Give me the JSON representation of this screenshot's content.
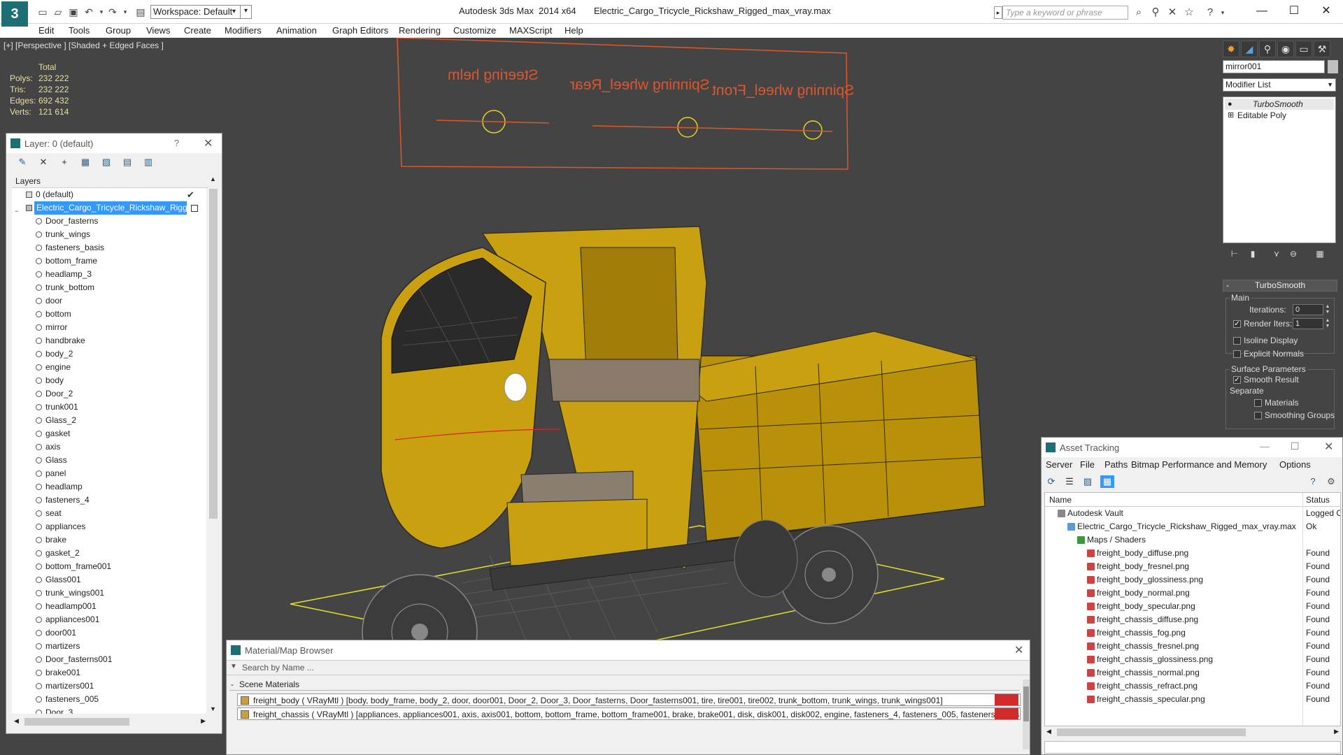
{
  "titlebar": {
    "app_logo": "3",
    "workspace": "Workspace: Default",
    "title": "Autodesk 3ds Max  2014 x64       Electric_Cargo_Tricycle_Rickshaw_Rigged_max_vray.max",
    "search_placeholder": "Type a keyword or phrase",
    "icons": [
      "binoculars-icon",
      "search-icon",
      "exchange-icon",
      "star-icon",
      "help-icon"
    ]
  },
  "menu": [
    "Edit",
    "Tools",
    "Group",
    "Views",
    "Create",
    "Modifiers",
    "Animation",
    "Graph Editors",
    "Rendering",
    "Customize",
    "MAXScript",
    "Help"
  ],
  "viewport": {
    "label": "[+] [Perspective ] [Shaded + Edged Faces ]",
    "stats": {
      "header": "Total",
      "rows": [
        {
          "label": "Polys:",
          "value": "232 222"
        },
        {
          "label": "Tris:",
          "value": "232 222"
        },
        {
          "label": "Edges:",
          "value": "692 432"
        },
        {
          "label": "Verts:",
          "value": "121 614"
        }
      ]
    },
    "rig_labels": [
      "Steering helm",
      "Spinning wheel_Rear",
      "Spinning wheel_Front"
    ],
    "colors": {
      "rig": "#e0552a",
      "vehicle": "#c8a010",
      "selection": "#e8e020"
    }
  },
  "layer_explorer": {
    "title": "Layer: 0 (default)",
    "help": "?",
    "header": "Layers",
    "default_layer": "0 (default)",
    "selected_layer": "Electric_Cargo_Tricycle_Rickshaw_Rigged",
    "objects": [
      "Door_fasterns",
      "trunk_wings",
      "fasteners_basis",
      "bottom_frame",
      "headlamp_3",
      "trunk_bottom",
      "door",
      "bottom",
      "mirror",
      "handbrake",
      "body_2",
      "engine",
      "body",
      "Door_2",
      "trunk001",
      "Glass_2",
      "gasket",
      "axis",
      "Glass",
      "panel",
      "headlamp",
      "fasteners_4",
      "seat",
      "appliances",
      "brake",
      "gasket_2",
      "bottom_frame001",
      "Glass001",
      "trunk_wings001",
      "headlamp001",
      "appliances001",
      "door001",
      "martizers",
      "Door_fasterns001",
      "brake001",
      "martizers001",
      "fasteners_005",
      "Door_3"
    ]
  },
  "command_panel": {
    "object_name": "mirror001",
    "modifier_list": "Modifier List",
    "stack": [
      "TurboSmooth",
      "Editable Poly"
    ],
    "rollout": {
      "title": "TurboSmooth",
      "main": "Main",
      "iterations_label": "Iterations:",
      "iterations_value": "0",
      "render_iters_label": "Render Iters:",
      "render_iters_value": "1",
      "isoline": "Isoline Display",
      "explicit": "Explicit Normals",
      "surface_params": "Surface Parameters",
      "smooth_result": "Smooth Result",
      "separate": "Separate",
      "materials": "Materials",
      "smoothing_groups": "Smoothing Groups"
    }
  },
  "asset_tracking": {
    "title": "Asset Tracking",
    "menu": [
      "Server",
      "File",
      "Paths",
      "Bitmap Performance and Memory",
      "Options"
    ],
    "columns": {
      "name": "Name",
      "status": "Status"
    },
    "rows": [
      {
        "name": "Autodesk Vault",
        "status": "Logged O"
      },
      {
        "name": "Electric_Cargo_Tricycle_Rickshaw_Rigged_max_vray.max",
        "status": "Ok"
      },
      {
        "name": "Maps / Shaders",
        "status": ""
      },
      {
        "name": "freight_body_diffuse.png",
        "status": "Found"
      },
      {
        "name": "freight_body_fresnel.png",
        "status": "Found"
      },
      {
        "name": "freight_body_glossiness.png",
        "status": "Found"
      },
      {
        "name": "freight_body_normal.png",
        "status": "Found"
      },
      {
        "name": "freight_body_specular.png",
        "status": "Found"
      },
      {
        "name": "freight_chassis_diffuse.png",
        "status": "Found"
      },
      {
        "name": "freight_chassis_fog.png",
        "status": "Found"
      },
      {
        "name": "freight_chassis_fresnel.png",
        "status": "Found"
      },
      {
        "name": "freight_chassis_glossiness.png",
        "status": "Found"
      },
      {
        "name": "freight_chassis_normal.png",
        "status": "Found"
      },
      {
        "name": "freight_chassis_refract.png",
        "status": "Found"
      },
      {
        "name": "freight_chassis_specular.png",
        "status": "Found"
      }
    ]
  },
  "material_browser": {
    "title": "Material/Map Browser",
    "search_placeholder": "Search by Name ...",
    "group": "Scene Materials",
    "materials": [
      "freight_body  ( VRayMtl ) [body, body_frame, body_2, door, door001, Door_2, Door_3, Door_fasterns, Door_fasterns001, tire, tire001, tire002, trunk_bottom, trunk_wings, trunk_wings001]",
      "freight_chassis  ( VRayMtl ) [appliances, appliances001, axis, axis001, bottom, bottom_frame, bottom_frame001, brake, brake001, disk, disk001, disk002, engine, fasteners_4, fasteners_005, fasteners_basis, folk, fol..."
    ]
  }
}
